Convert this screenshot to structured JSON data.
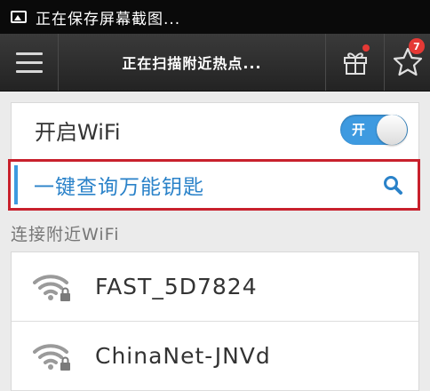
{
  "status_bar": {
    "text": "正在保存屏幕截图..."
  },
  "header": {
    "title": "正在扫描附近热点...",
    "badge_count": "7"
  },
  "wifi_switch": {
    "label": "开启WiFi",
    "state_text": "开",
    "on": true
  },
  "search": {
    "label": "一键查询万能钥匙"
  },
  "nearby": {
    "section_title": "连接附近WiFi",
    "networks": [
      {
        "name": "FAST_5D7824",
        "locked": true
      },
      {
        "name": "ChinaNet-JNVd",
        "locked": true
      }
    ]
  },
  "colors": {
    "accent": "#3e9ae0",
    "highlight_border": "#c8202c",
    "badge": "#e53935"
  },
  "icons": [
    "menu-icon",
    "gift-icon",
    "star-icon",
    "search-icon",
    "wifi-lock-icon"
  ]
}
